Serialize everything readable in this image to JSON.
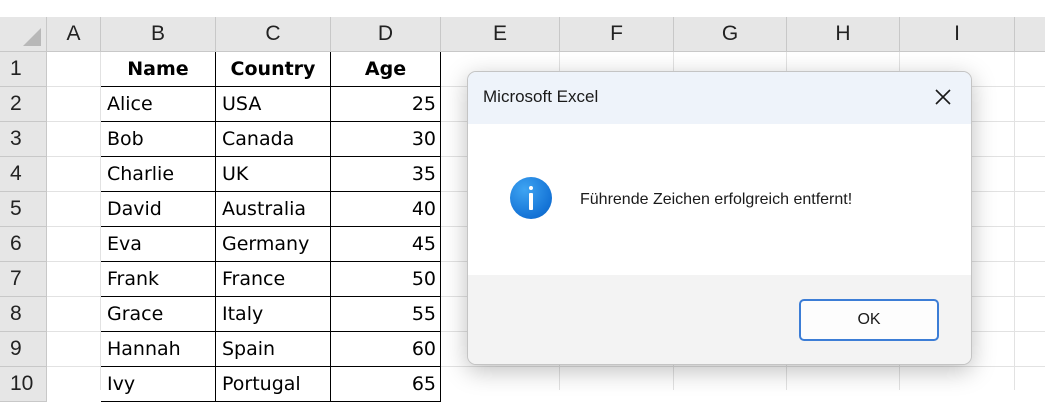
{
  "columns": [
    "A",
    "B",
    "C",
    "D",
    "E",
    "F",
    "G",
    "H",
    "I"
  ],
  "rows": [
    "1",
    "2",
    "3",
    "4",
    "5",
    "6",
    "7",
    "8",
    "9",
    "10"
  ],
  "table": {
    "headers": [
      "Name",
      "Country",
      "Age"
    ],
    "records": [
      [
        "Alice",
        "USA",
        "25"
      ],
      [
        "Bob",
        "Canada",
        "30"
      ],
      [
        "Charlie",
        "UK",
        "35"
      ],
      [
        "David",
        "Australia",
        "40"
      ],
      [
        "Eva",
        "Germany",
        "45"
      ],
      [
        "Frank",
        "France",
        "50"
      ],
      [
        "Grace",
        "Italy",
        "55"
      ],
      [
        "Hannah",
        "Spain",
        "60"
      ],
      [
        "Ivy",
        "Portugal",
        "65"
      ]
    ]
  },
  "dialog": {
    "title": "Microsoft Excel",
    "message": "Führende Zeichen erfolgreich entfernt!",
    "ok_label": "OK",
    "icon": "info-icon",
    "close_icon": "close-icon"
  },
  "colors": {
    "header_bg": "#e6e6e6",
    "dialog_accent": "#3c7dd6",
    "info_icon": "#1473d6"
  }
}
